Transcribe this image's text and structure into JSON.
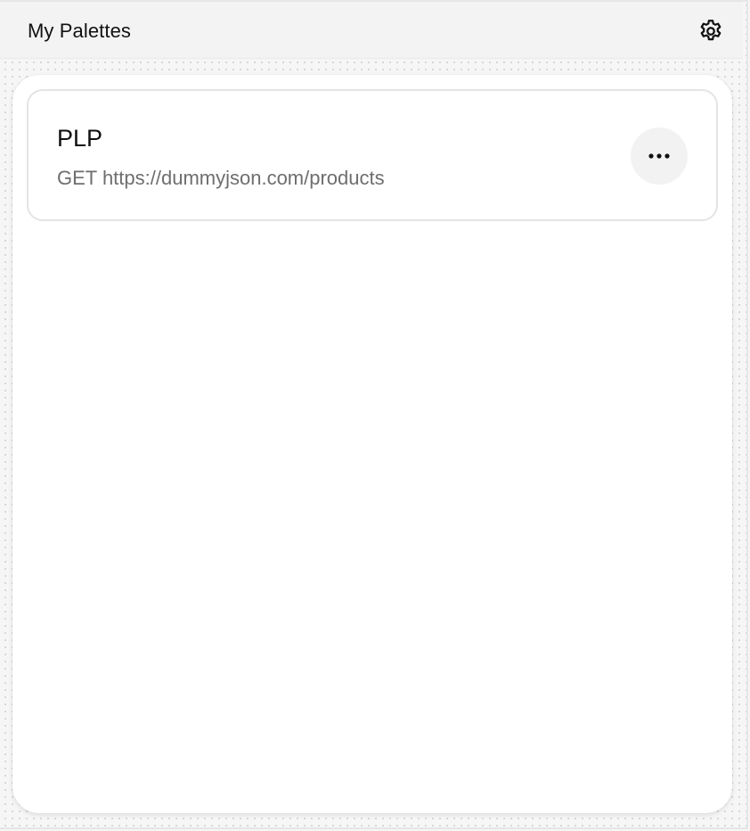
{
  "header": {
    "title": "My Palettes",
    "settings_icon": "gear-icon"
  },
  "palettes": [
    {
      "name": "PLP",
      "request": "GET https://dummyjson.com/products",
      "menu_icon": "more-horizontal-icon"
    }
  ],
  "colors": {
    "header_bg": "#f3f3f3",
    "panel_bg": "#ffffff",
    "title_text": "#111111",
    "subtitle_text": "#6e6e6e",
    "more_button_bg": "#f2f2f2"
  }
}
